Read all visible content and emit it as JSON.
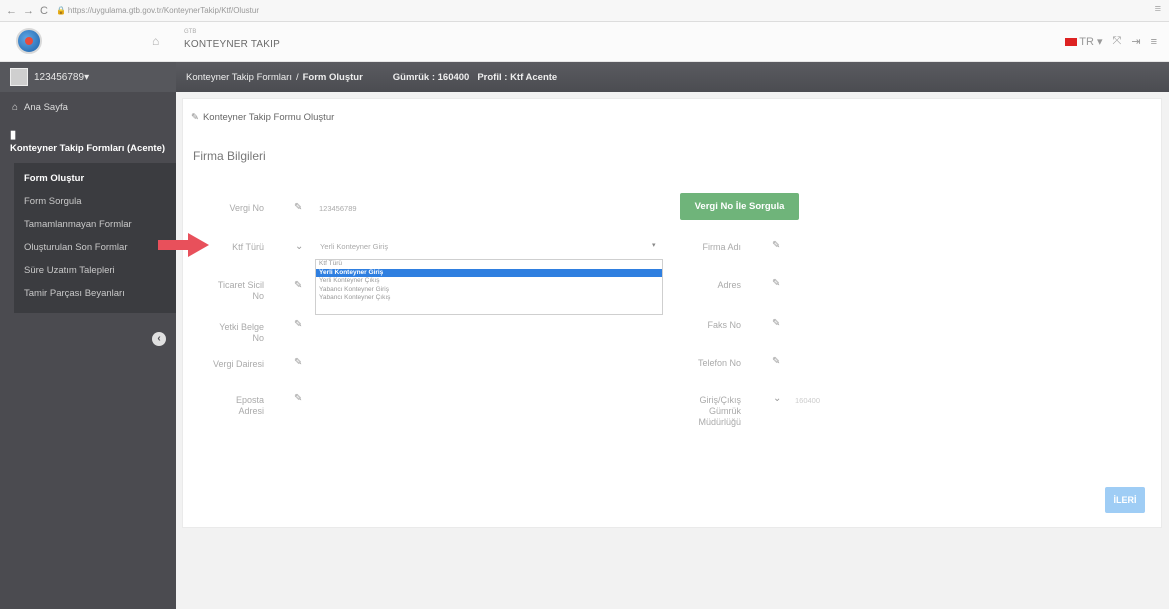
{
  "browser": {
    "url": "https://uygulama.gtb.gov.tr/KonteynerTakip/Ktf/Olustur",
    "back": "←",
    "forward": "→",
    "reload": "C"
  },
  "header": {
    "subtitle": "GTB",
    "title": "KONTEYNER TAKIP",
    "language": "TR",
    "icons": [
      "flag-icon",
      "fullscreen-icon",
      "logout-icon",
      "menu-icon"
    ]
  },
  "sidebar": {
    "user": "123456789",
    "home": "Ana Sayfa",
    "section": "Konteyner Takip Formları (Acente)",
    "items": [
      {
        "label": "Form Oluştur",
        "active": true
      },
      {
        "label": "Form Sorgula",
        "active": false
      },
      {
        "label": "Tamamlanmayan Formlar",
        "active": false
      },
      {
        "label": "Oluşturulan Son Formlar",
        "active": false
      },
      {
        "label": "Süre Uzatım Talepleri",
        "active": false
      },
      {
        "label": "Tamir Parçası Beyanları",
        "active": false
      }
    ]
  },
  "topbar": {
    "crumb1": "Konteyner Takip Formları",
    "separator": "/",
    "crumb2": "Form Oluştur",
    "customs": "Gümrük : 160400",
    "profile": "Profil : Ktf Acente"
  },
  "panel": {
    "title": "Konteyner Takip Formu Oluştur",
    "section": "Firma Bilgileri"
  },
  "form": {
    "vergi_no_label": "Vergi No",
    "vergi_no_value": "123456789",
    "query_button": "Vergi No İle Sorgula",
    "ktf_turu_label": "Ktf Türü",
    "ktf_turu_selected": "Yerli Konteyner Giriş",
    "ktf_options": [
      "Ktf Türü",
      "Yerli Konteyner Giriş",
      "Yerli Konteyner Çıkış",
      "Yabancı Konteyner Giriş",
      "Yabancı Konteyner Çıkış"
    ],
    "ktf_selected_index": 1,
    "ticaret_sicil_label_1": "Ticaret Sicil",
    "ticaret_sicil_label_2": "No",
    "yetki_belge_label_1": "Yetki Belge",
    "yetki_belge_label_2": "No",
    "vergi_dairesi_label": "Vergi Dairesi",
    "eposta_label_1": "Eposta",
    "eposta_label_2": "Adresi",
    "firma_adi_label": "Firma Adı",
    "adres_label": "Adres",
    "faks_label": "Faks No",
    "telefon_label": "Telefon No",
    "giris_cikis_label_1": "Giriş/Çıkış",
    "giris_cikis_label_2": "Gümrük",
    "giris_cikis_label_3": "Müdürlüğü",
    "giris_cikis_value": "160400",
    "next_button": "İLERİ"
  },
  "colors": {
    "sidebar": "#4b4b50",
    "query_button": "#6fb47a",
    "next_button": "#9fcdf5",
    "dropdown_selected": "#2f7fe0",
    "annotation_arrow": "#e8505b"
  }
}
